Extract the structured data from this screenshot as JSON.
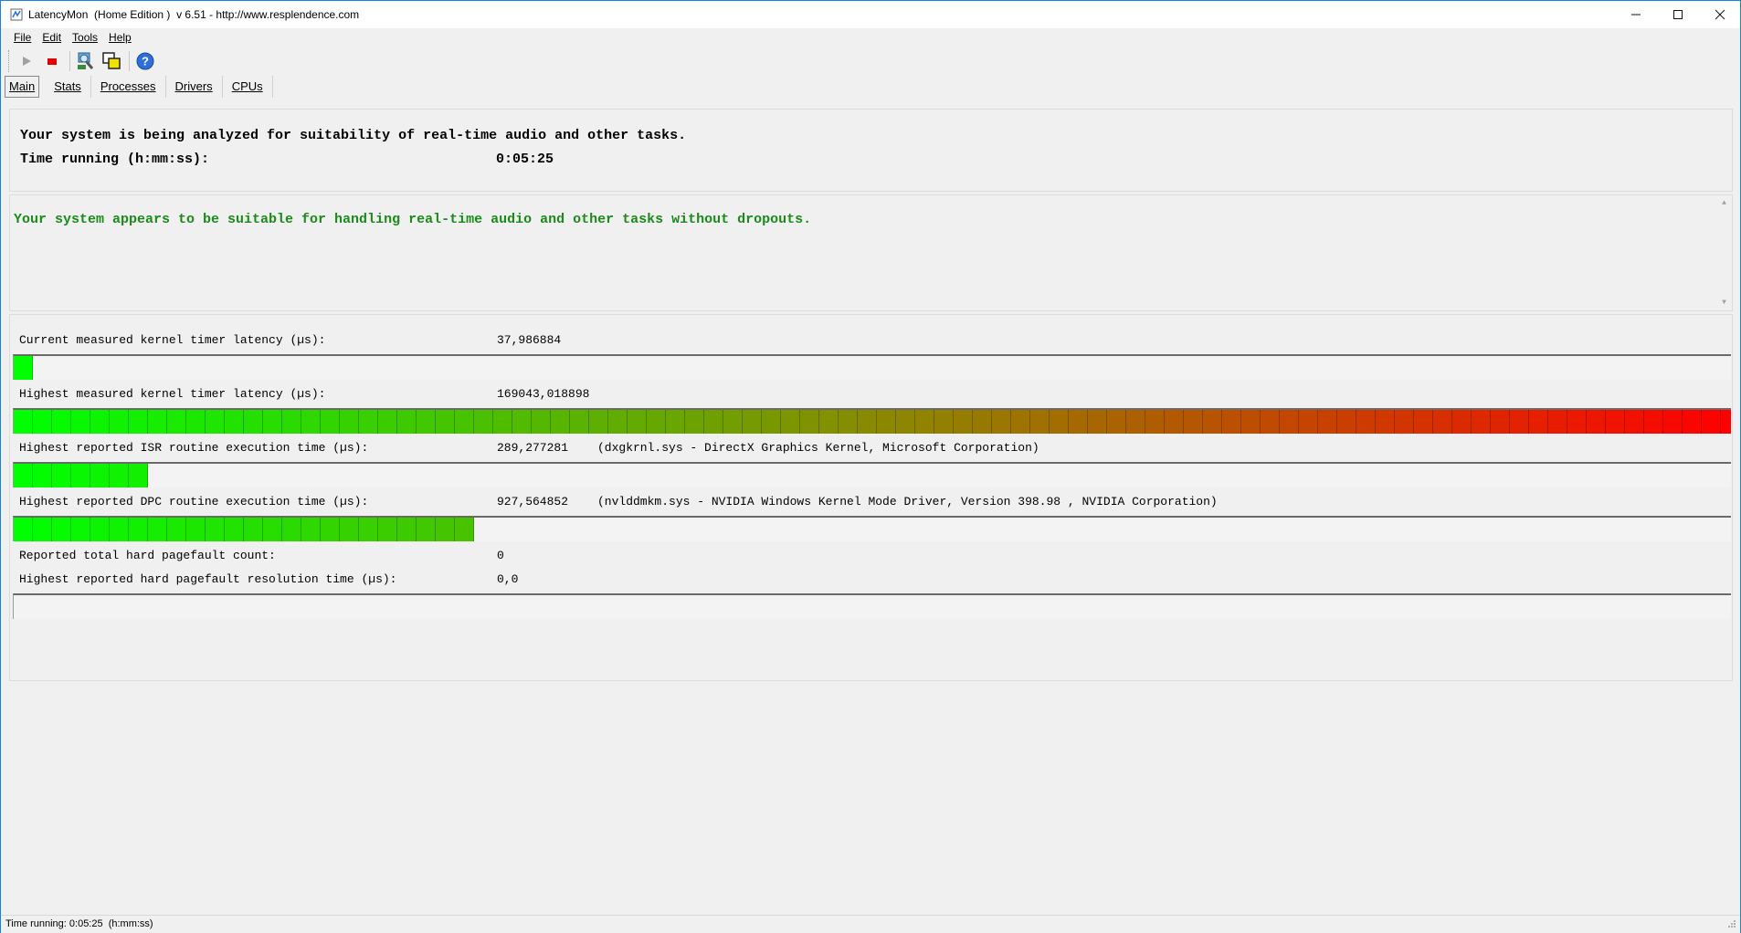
{
  "window": {
    "title": "LatencyMon  (Home Edition )  v 6.51 - http://www.resplendence.com"
  },
  "menu": [
    {
      "label": "File"
    },
    {
      "label": "Edit"
    },
    {
      "label": "Tools"
    },
    {
      "label": "Help"
    }
  ],
  "toolbar": {
    "icons": [
      "play-icon",
      "stop-icon",
      "driver-search-icon",
      "windows-icon",
      "help-icon"
    ]
  },
  "tabs": [
    {
      "label": "Main",
      "active": true
    },
    {
      "label": "Stats"
    },
    {
      "label": "Processes"
    },
    {
      "label": "Drivers"
    },
    {
      "label": "CPUs"
    }
  ],
  "main": {
    "analyzing_text": "Your system is being analyzed for suitability of real-time audio and other tasks.",
    "time_running_label": "Time running (h:mm:ss):",
    "time_running_value": "0:05:25",
    "verdict": "Your system appears to be suitable for handling real-time audio and other tasks without dropouts.",
    "verdict_color": "#1b8a1b"
  },
  "stats": {
    "current_latency": {
      "label": "Current measured kernel timer latency (µs):",
      "value": "37,986884",
      "bar_segments": 1
    },
    "highest_latency": {
      "label": "Highest measured kernel timer latency (µs):",
      "value": "169043,018898",
      "bar_segments": 90
    },
    "highest_isr": {
      "label": "Highest reported ISR routine execution time (µs):",
      "value": "289,277281",
      "extra": "(dxgkrnl.sys - DirectX Graphics Kernel, Microsoft Corporation)",
      "bar_segments": 7
    },
    "highest_dpc": {
      "label": "Highest reported DPC routine execution time (µs):",
      "value": "927,564852",
      "extra": "(nvlddmkm.sys - NVIDIA Windows Kernel Mode Driver, Version 398.98 , NVIDIA Corporation)",
      "bar_segments": 24
    },
    "pagefault_count": {
      "label": "Reported total hard pagefault count:",
      "value": "0"
    },
    "pagefault_time": {
      "label": "Highest reported hard pagefault resolution time (µs):",
      "value": "0,0",
      "bar_segments": 0
    },
    "bar_colors": {
      "low": "#00ff00",
      "mid": "#8a8a00",
      "high": "#ff0000"
    }
  },
  "statusbar": {
    "text": "Time running: 0:05:25  (h:mm:ss)"
  }
}
